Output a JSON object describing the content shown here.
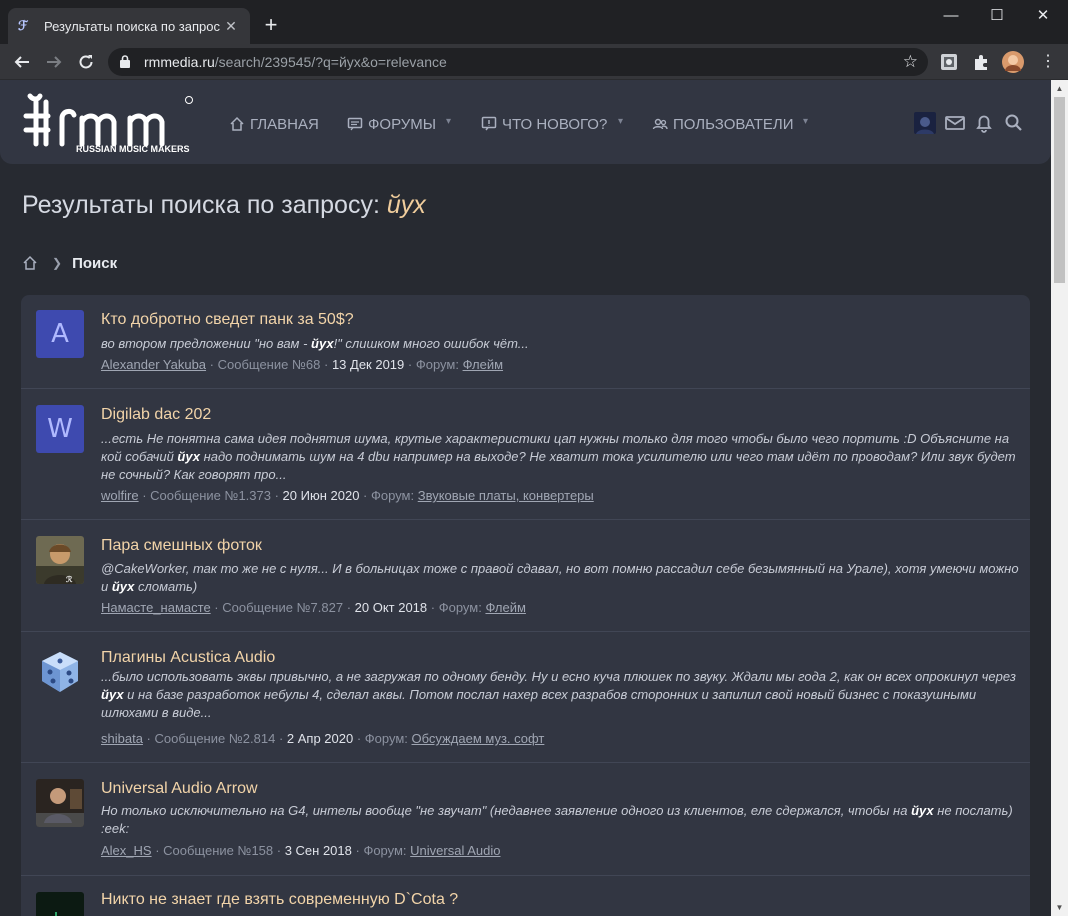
{
  "browser": {
    "tab_title": "Результаты поиска по запросу: й",
    "url_host": "rmmedia.ru",
    "url_path": "/search/239545/?q=йух&o=relevance",
    "controls": {
      "minimize": "—",
      "maximize": "☐",
      "close": "✕",
      "new_tab": "+",
      "tab_close": "✕"
    }
  },
  "site": {
    "logo_subtitle": "RUSSIAN MUSIC MAKERS",
    "nav": [
      {
        "label": "ГЛАВНАЯ",
        "icon": "home-icon"
      },
      {
        "label": "ФОРУМЫ",
        "icon": "forum-icon"
      },
      {
        "label": "ЧТО НОВОГО?",
        "icon": "whats-new-icon"
      },
      {
        "label": "ПОЛЬЗОВАТЕЛИ",
        "icon": "users-icon"
      }
    ]
  },
  "page": {
    "title_prefix": "Результаты поиска по запросу:",
    "query": "йух",
    "breadcrumb_current": "Поиск"
  },
  "results": [
    {
      "title": "Кто добротно сведет панк за 50$?",
      "snippet_parts": [
        "во втором предложении \"но вам - ",
        "йух",
        "!\" слишком много ошибок чёт..."
      ],
      "author": "Alexander Yakuba",
      "post": "Сообщение №68",
      "date": "13 Дек 2019",
      "forum_label": "Форум:",
      "forum": "Флейм",
      "avatar_letter": "A"
    },
    {
      "title": "Digilab dac 202",
      "snippet_parts": [
        "...есть Не понятна сама идея поднятия шума, крутые характеристики цап нужны только для того чтобы было чего портить :D Объясните на кой собачий ",
        "йух",
        " надо поднимать шум на 4 dbu например на выходе? Не хватит тока усилителю или чего там идёт по проводам? Или звук будет не сочный? Как говорят про..."
      ],
      "author": "wolfire",
      "post": "Сообщение №1.373",
      "date": "20 Июн 2020",
      "forum_label": "Форум:",
      "forum": "Звуковые платы, конвертеры",
      "avatar_letter": "W"
    },
    {
      "title": "Пара смешных фоток",
      "snippet_parts": [
        "@CakeWorker, так то же не с нуля... И в больницах тоже с правой сдавал, но вот помню рассадил себе безымянный на Урале), хотя умеючи можно и ",
        "йух",
        " сломать)"
      ],
      "author": "Намасте_намасте",
      "post": "Сообщение №7.827",
      "date": "20 Окт 2018",
      "forum_label": "Форум:",
      "forum": "Флейм"
    },
    {
      "title": "Плагины Acustica Audio",
      "snippet_parts": [
        "...было использовать эквы привычно, а не загружая по одному бенду. Ну и есно куча плюшек по звуку. Ждали мы года 2, как он всех опрокинул через ",
        "йух",
        " и на базе разработок небулы 4, сделал аквы. Потом послал нахер всех разрабов сторонних и запилил свой новый бизнес с показушными шлюхами в виде..."
      ],
      "author": "shibata",
      "post": "Сообщение №2.814",
      "date": "2 Апр 2020",
      "forum_label": "Форум:",
      "forum": "Обсуждаем муз. софт"
    },
    {
      "title": "Universal Audio Arrow",
      "snippet_parts": [
        "Но только исключительно на G4, интелы вообще \"не звучат\" (недавнее заявление одного из клиентов, еле сдержался, чтобы на ",
        "йух",
        " не послать) :eek:"
      ],
      "author": "Alex_HS",
      "post": "Сообщение №158",
      "date": "3 Сен 2018",
      "forum_label": "Форум:",
      "forum": "Universal Audio"
    },
    {
      "title": "Никто не знает где взять современную D`Cota ?"
    }
  ]
}
